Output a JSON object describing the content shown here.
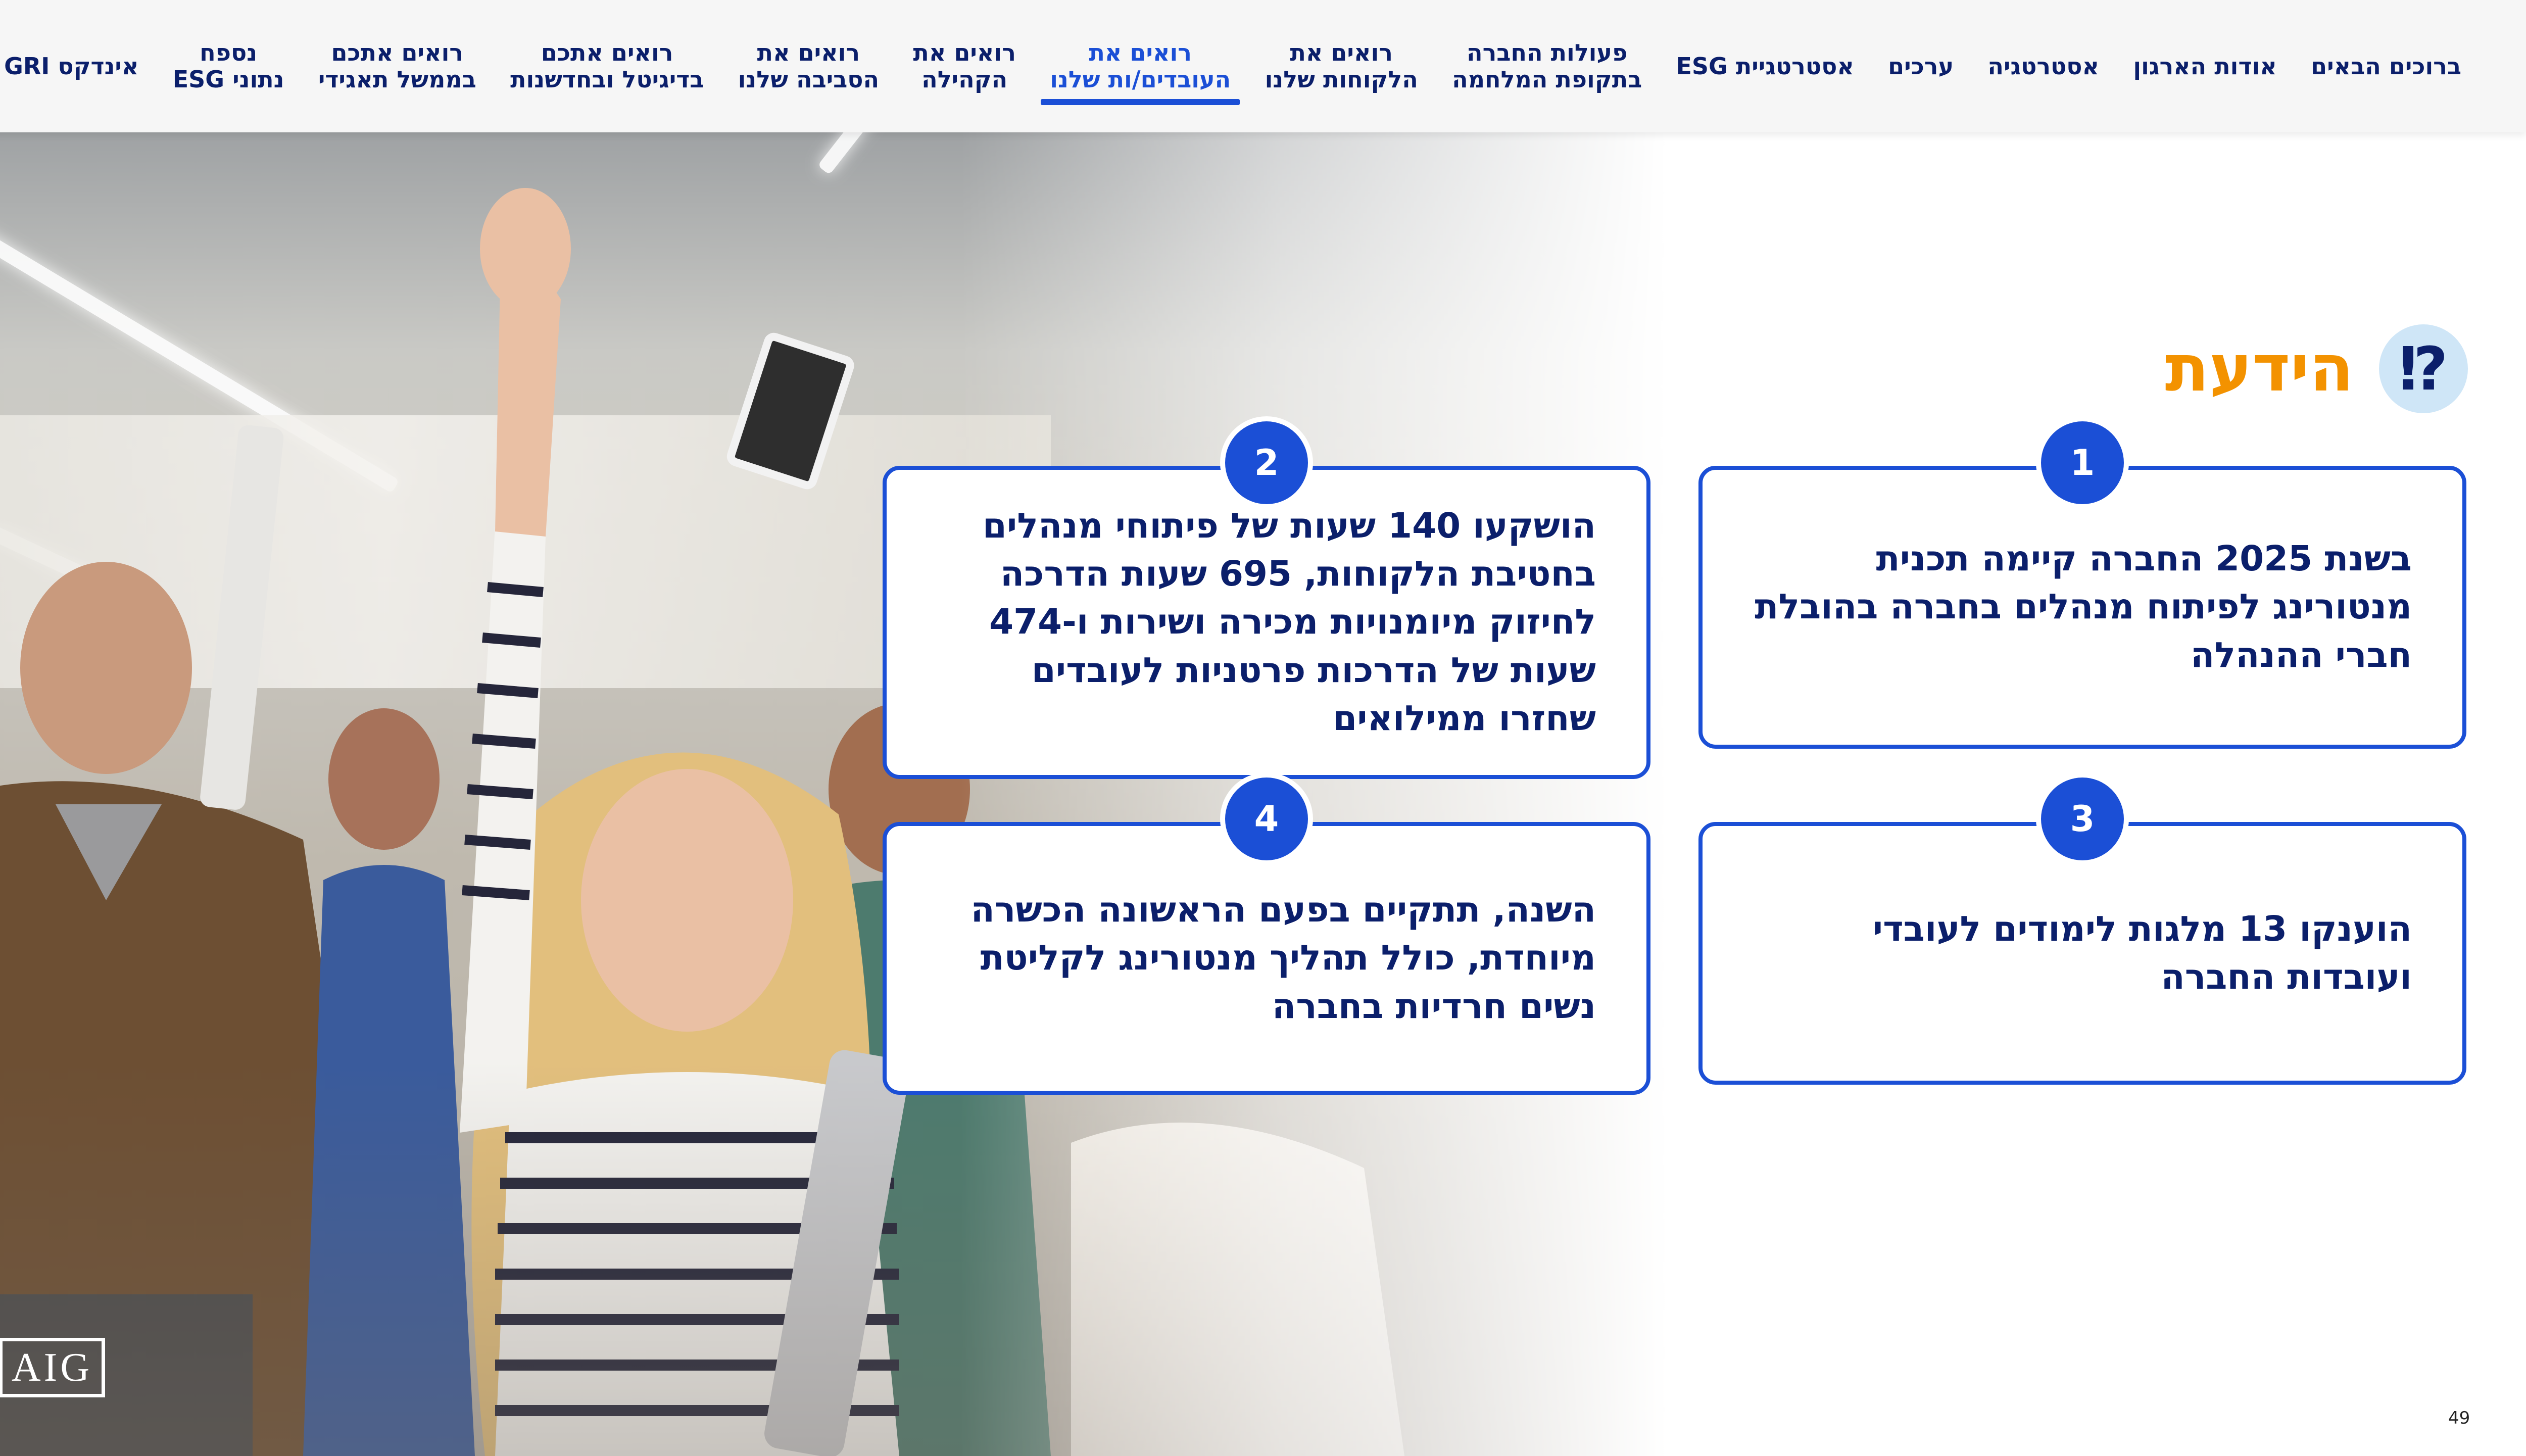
{
  "nav": {
    "items": [
      {
        "label": "ברוכים הבאים",
        "active": false
      },
      {
        "label": "אודות הארגון",
        "active": false
      },
      {
        "label": "אסטרטגיה",
        "active": false
      },
      {
        "label": "ערכים",
        "active": false
      },
      {
        "label": "אסטרטגיית ESG",
        "active": false
      },
      {
        "label": "פעולות החברה\nבתקופת המלחמה",
        "active": false
      },
      {
        "label": "רואים את\nהלקוחות שלנו",
        "active": false
      },
      {
        "label": "רואים את\nהעובדים/ות שלנו",
        "active": true
      },
      {
        "label": "רואים את\nהקהילה",
        "active": false
      },
      {
        "label": "רואים את\nהסביבה שלנו",
        "active": false
      },
      {
        "label": "רואים אתכם\nבדיגיטל ובחדשנות",
        "active": false
      },
      {
        "label": "רואים אתכם\nבממשל תאגידי",
        "active": false
      },
      {
        "label": "נספח\nנתוני ESG",
        "active": false
      },
      {
        "label": "אינדקס GRI",
        "active": false
      }
    ]
  },
  "section": {
    "icon_glyph": "⁉",
    "icon_name": "exclamation-question-icon",
    "title": "הידעת"
  },
  "facts": [
    {
      "number": "1",
      "text": "בשנת 2025 החברה קיימה תכנית מנטורינג לפיתוח מנהלים בחברה בהובלת חברי ההנהלה"
    },
    {
      "number": "2",
      "text": "הושקעו 140 שעות של פיתוחי מנהלים בחטיבת הלקוחות, 695 שעות הדרכה לחיזוק מיומנויות מכירה ושירות ו-474 שעות של הדרכות פרטניות לעובדים שחזרו ממילואים"
    },
    {
      "number": "3",
      "text": "הוענקו 13 מלגות לימודים לעובדי ועובדות החברה"
    },
    {
      "number": "4",
      "text": "השנה, תתקיים בפעם הראשונה הכשרה מיוחדת, כולל תהליך מנטורינג לקליטת נשים חרדיות בחברה"
    }
  ],
  "logo": {
    "text": "AIG"
  },
  "page_number": "49",
  "colors": {
    "navy": "#0b1f6b",
    "blue": "#1b4fd6",
    "orange": "#f39200"
  }
}
